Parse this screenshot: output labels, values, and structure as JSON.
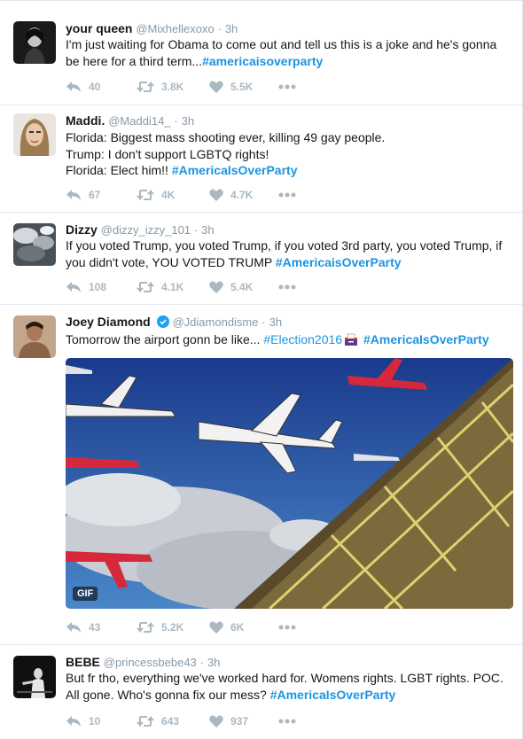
{
  "tweets": [
    {
      "name": "your queen",
      "handle": "@Mixhellexoxo",
      "separator": "·",
      "time": "3h",
      "text_parts": [
        "I'm just waiting for Obama to come out and tell us this is a joke and he's gonna be here for a third term..."
      ],
      "hashtag": "#americaisoverparty",
      "replies": "40",
      "retweets": "3.8K",
      "likes": "5.5K"
    },
    {
      "name": "Maddi.",
      "handle": "@Maddi14_",
      "separator": "·",
      "time": "3h",
      "line1": "Florida: Biggest mass shooting ever, killing 49 gay people.",
      "line2": "Trump: I don't support LGBTQ rights!",
      "line3": "Florida: Elect him!! ",
      "hashtag": "#AmericaIsOverParty",
      "replies": "67",
      "retweets": "4K",
      "likes": "4.7K"
    },
    {
      "name": "Dizzy",
      "handle": "@dizzy_izzy_101",
      "separator": "·",
      "time": "3h",
      "text": "If you voted Trump, you voted Trump, if you voted 3rd party, you voted Trump, if you didn't vote, YOU VOTED TRUMP ",
      "hashtag": "#AmericaisOverParty",
      "replies": "108",
      "retweets": "4.1K",
      "likes": "5.4K"
    },
    {
      "name": "Joey Diamond",
      "handle": "@Jdiamondisme",
      "separator": "·",
      "time": "3h",
      "text": "Tomorrow the airport gonn be like... ",
      "hashtag1": "#Election2016",
      "hashtag2": "#AmericaIsOverParty",
      "gif_label": "GIF",
      "replies": "43",
      "retweets": "5.2K",
      "likes": "6K"
    },
    {
      "name": "BEBE",
      "handle": "@princessbebe43",
      "separator": "·",
      "time": "3h",
      "text": "But fr tho, everything we've worked hard for. Womens rights. LGBT rights. POC. All gone. Who's gonna fix our mess? ",
      "hashtag": "#AmericaIsOverParty",
      "replies": "10",
      "retweets": "643",
      "likes": "937"
    }
  ],
  "icons": {
    "reply": "reply-icon",
    "retweet": "retweet-icon",
    "like": "heart-icon",
    "more": "more-icon",
    "verified": "verified-badge-icon"
  },
  "colors": {
    "accent": "#1b95e0",
    "icon_gray": "#aab8c2",
    "verified": "#1da1f2"
  }
}
